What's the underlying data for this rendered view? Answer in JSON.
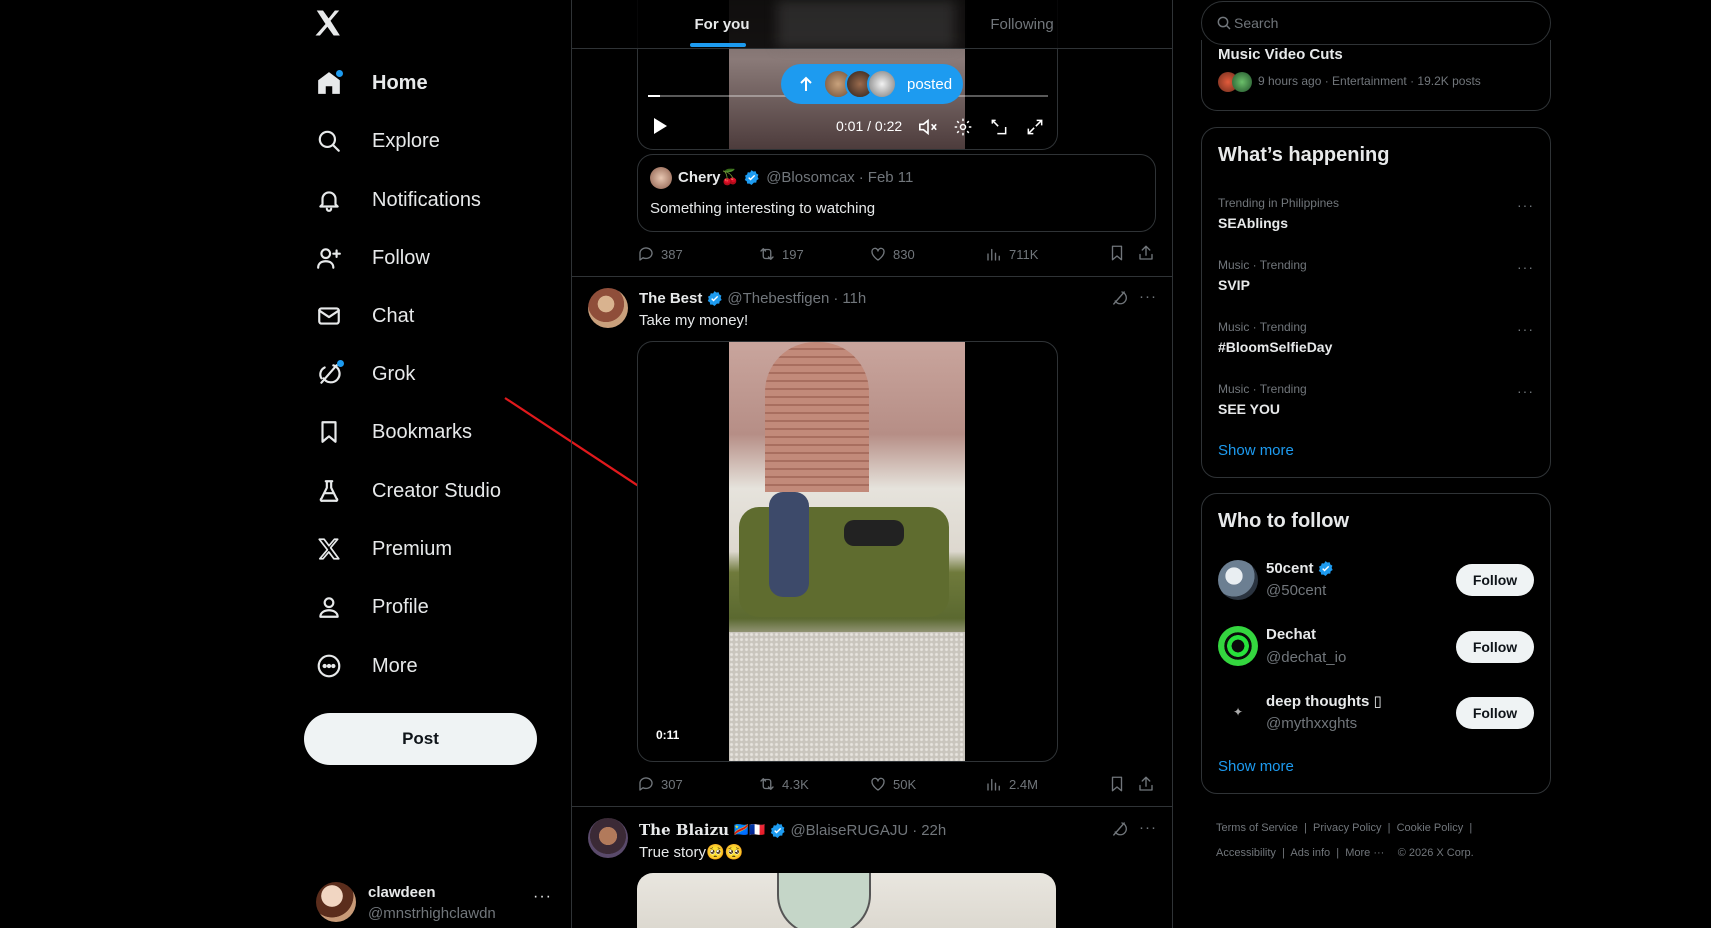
{
  "nav": {
    "items": [
      {
        "label": "Home",
        "icon": "home-icon"
      },
      {
        "label": "Explore",
        "icon": "search-icon"
      },
      {
        "label": "Notifications",
        "icon": "bell-icon"
      },
      {
        "label": "Follow",
        "icon": "person-add-icon"
      },
      {
        "label": "Chat",
        "icon": "mail-icon"
      },
      {
        "label": "Grok",
        "icon": "grok-icon"
      },
      {
        "label": "Bookmarks",
        "icon": "bookmark-icon"
      },
      {
        "label": "Creator Studio",
        "icon": "creator-studio-icon"
      },
      {
        "label": "Premium",
        "icon": "x-logo-icon"
      },
      {
        "label": "Profile",
        "icon": "person-icon"
      },
      {
        "label": "More",
        "icon": "more-circle-icon"
      }
    ],
    "post_label": "Post",
    "account": {
      "name": "clawdeen",
      "handle": "@mnstrhighclawdn"
    }
  },
  "tabs": {
    "for_you": "For you",
    "following": "Following"
  },
  "new_posts_pill": {
    "label": "posted"
  },
  "video1": {
    "time": "0:01 / 0:22"
  },
  "quote": {
    "name": "Chery🍒",
    "handle": "@Blosomcax",
    "date": "Feb 11",
    "text": "Something interesting to watching"
  },
  "post1_stats": {
    "replies": "387",
    "reposts": "197",
    "likes": "830",
    "views": "711K"
  },
  "post2": {
    "name": "The Best",
    "handle": "@Thebestfigen",
    "time": "11h",
    "text": "Take my money!",
    "video_duration": "0:11",
    "stats": {
      "replies": "307",
      "reposts": "4.3K",
      "likes": "50K",
      "views": "2.4M"
    }
  },
  "post3": {
    "name": "The Blaizu",
    "flags": "🇨🇩🇫🇷",
    "handle": "@BlaiseRUGAJU",
    "time": "22h",
    "text": "True story🥺🥺"
  },
  "search": {
    "placeholder": "Search"
  },
  "top_trend": {
    "name": "Music Video Cuts",
    "meta": "9 hours ago · Entertainment · 19.2K posts"
  },
  "happening": {
    "title": "What’s happening",
    "trends": [
      {
        "meta": "Trending in Philippines",
        "name": "SEAblings"
      },
      {
        "meta": "Music · Trending",
        "name": "SVIP"
      },
      {
        "meta": "Music · Trending",
        "name": "#BloomSelfieDay"
      },
      {
        "meta": "Music · Trending",
        "name": "SEE YOU"
      }
    ],
    "show_more": "Show more"
  },
  "who_to_follow": {
    "title": "Who to follow",
    "accounts": [
      {
        "name": "50cent",
        "handle": "@50cent",
        "verified": true
      },
      {
        "name": "Dechat",
        "handle": "@dechat_io",
        "verified": false
      },
      {
        "name": "deep thoughts ▯",
        "handle": "@mythxxghts",
        "verified": false
      }
    ],
    "follow_label": "Follow",
    "show_more": "Show more"
  },
  "footer": {
    "links": [
      "Terms of Service",
      "Privacy Policy",
      "Cookie Policy",
      "Accessibility",
      "Ads info",
      "More ···",
      "© 2026 X Corp."
    ]
  },
  "colors": {
    "accent": "#1d9bf0",
    "background": "#000000",
    "border": "#2f3336",
    "muted": "#71767b",
    "annotation_arrow": "#e0191c"
  }
}
